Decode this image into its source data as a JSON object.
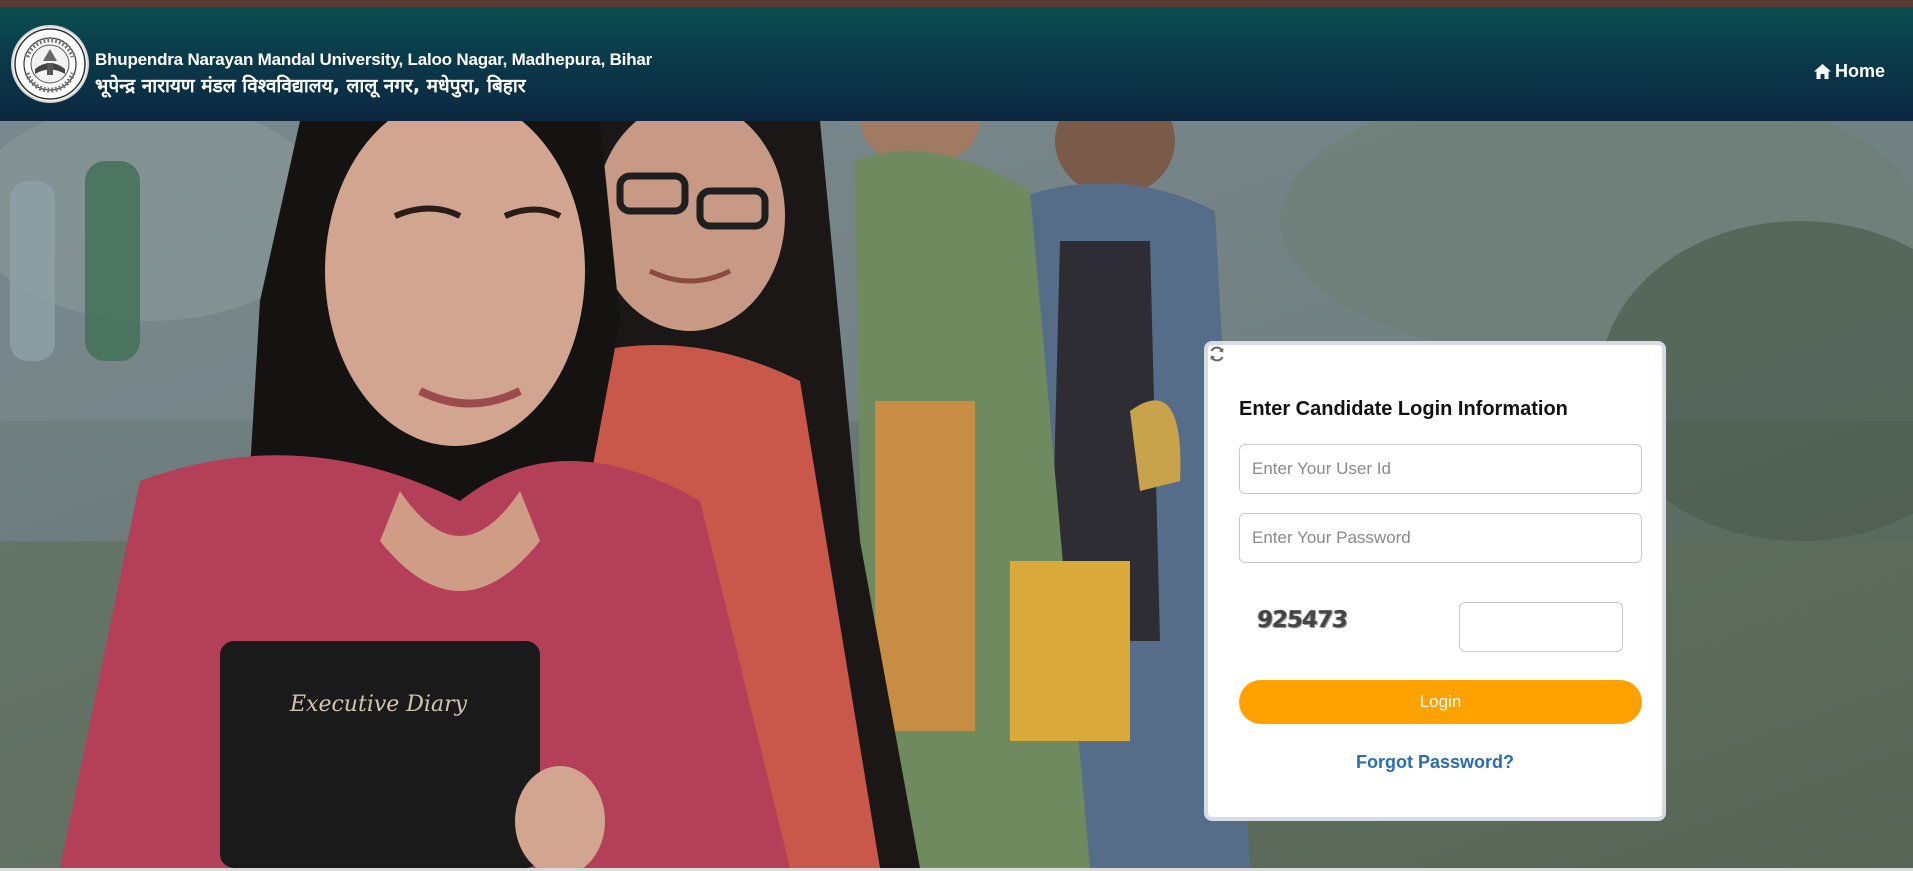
{
  "header": {
    "university_name_en": "Bhupendra Narayan Mandal University, Laloo Nagar, Madhepura, Bihar",
    "university_name_hi": "भूपेन्द्र नारायण मंडल विश्वविद्यालय, लालू नगर, मधेपुरा, बिहार",
    "home_label": "Home",
    "home_icon": "home-icon",
    "logo_icon": "university-seal-logo"
  },
  "login": {
    "title": "Enter Candidate Login Information",
    "user_id_placeholder": "Enter Your User Id",
    "user_id_value": "",
    "password_placeholder": "Enter Your Password",
    "password_value": "",
    "captcha_code": "925473",
    "captcha_refresh_icon": "refresh-icon",
    "captcha_input_value": "",
    "login_button_label": "Login",
    "forgot_password_label": "Forgot Password?"
  },
  "colors": {
    "header_gradient_top": "#0b4f4f",
    "header_gradient_bottom": "#0c2740",
    "login_button": "#ffa200",
    "link": "#2a6db0"
  }
}
